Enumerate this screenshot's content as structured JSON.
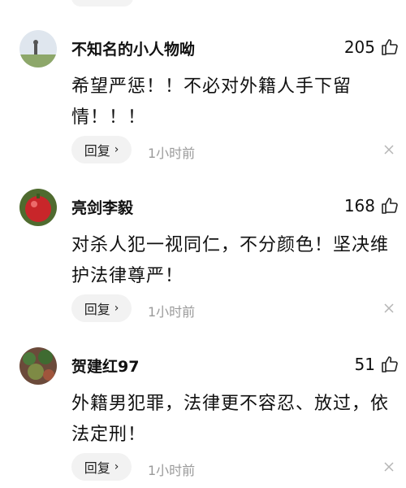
{
  "comments": [
    {
      "username": "不知名的小人物呦",
      "likes": "205",
      "content_line1": "希望严惩！！不必对外籍人手下留",
      "content_line2": "情！！！",
      "reply_label": "回复",
      "reply_chevron": "›",
      "time": "1小时前"
    },
    {
      "username": "亮剑李毅",
      "likes": "168",
      "content_line1": "对杀人犯一视同仁，不分颜色！坚决维",
      "content_line2": "护法律尊严！",
      "reply_label": "回复",
      "reply_chevron": "›",
      "time": "1小时前"
    },
    {
      "username": "贺建红97",
      "likes": "51",
      "content_line1": "外籍男犯罪，法律更不容忍、放过，依",
      "content_line2": "法定刑！",
      "reply_label": "回复",
      "reply_chevron": "›",
      "time": "1小时前"
    }
  ],
  "icons": {
    "like": "thumbs-up-icon",
    "dismiss": "close-icon",
    "reply_arrow": "chevron-right-icon"
  },
  "colors": {
    "text": "#111111",
    "muted": "#9a9a9a",
    "pill_bg": "#f2f2f2"
  }
}
